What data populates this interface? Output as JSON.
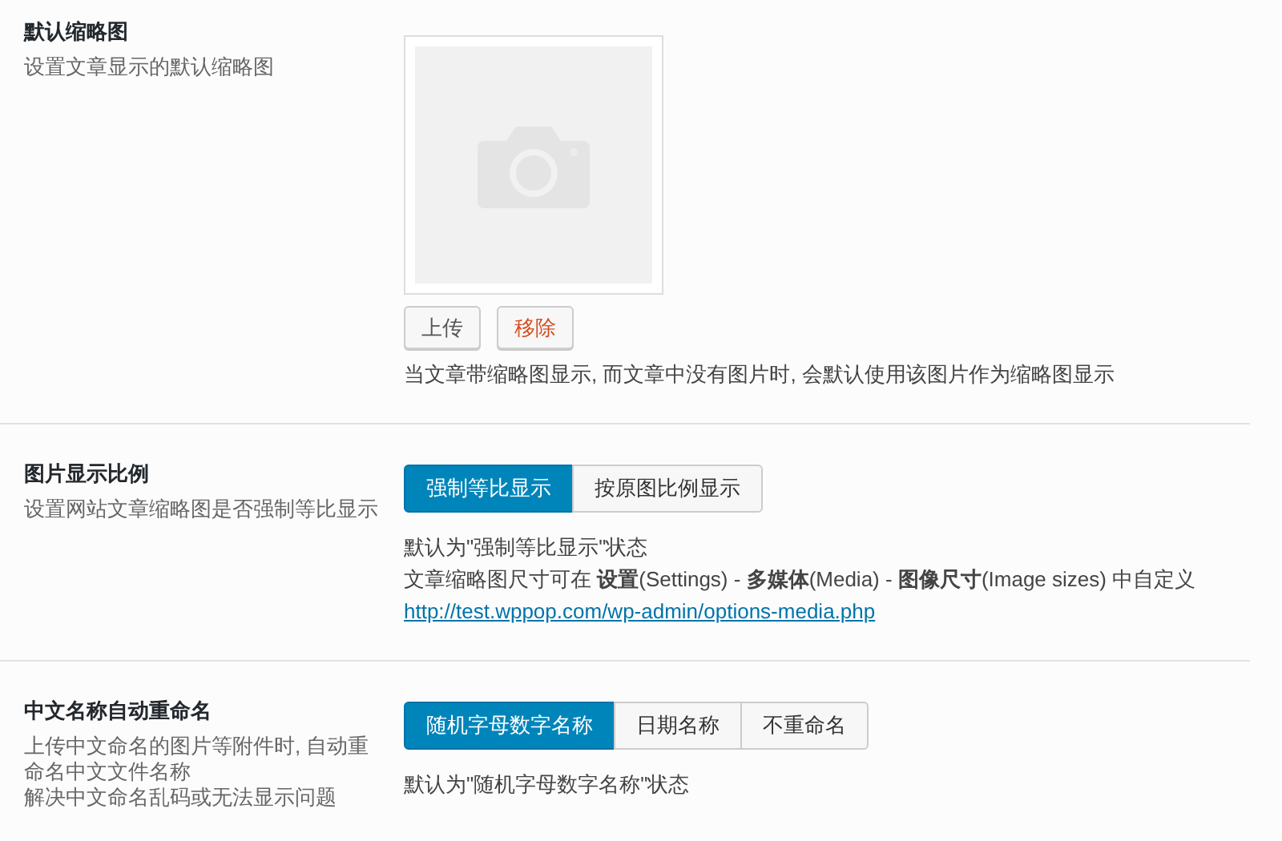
{
  "sections": [
    {
      "kind": "thumbnail",
      "title": "默认缩略图",
      "description": [
        "设置文章显示的默认缩略图"
      ],
      "buttons": [
        {
          "label": "上传",
          "kind": "default"
        },
        {
          "label": "移除",
          "kind": "danger"
        }
      ],
      "notes": [
        "当文章带缩略图显示, 而文章中没有图片时, 会默认使用该图片作为缩略图显示"
      ]
    },
    {
      "kind": "choice",
      "title": "图片显示比例",
      "description": [
        "设置网站文章缩略图是否强制等比显示"
      ],
      "options": [
        {
          "label": "强制等比显示",
          "selected": true
        },
        {
          "label": "按原图比例显示",
          "selected": false
        }
      ],
      "notes": [
        "默认为\"强制等比显示\"状态",
        "文章缩略图尺寸可在 **设置**(Settings) - **多媒体**(Media) - **图像尺寸**(Image sizes) 中自定义"
      ],
      "link": "http://test.wppop.com/wp-admin/options-media.php"
    },
    {
      "kind": "choice",
      "title": "中文名称自动重命名",
      "description": [
        "上传中文命名的图片等附件时, 自动重命名中文文件名称",
        "解决中文命名乱码或无法显示问题"
      ],
      "options": [
        {
          "label": "随机字母数字名称",
          "selected": true
        },
        {
          "label": "日期名称",
          "selected": false
        },
        {
          "label": "不重命名",
          "selected": false
        }
      ],
      "notes": [
        "默认为\"随机字母数字名称\"状态"
      ]
    }
  ]
}
